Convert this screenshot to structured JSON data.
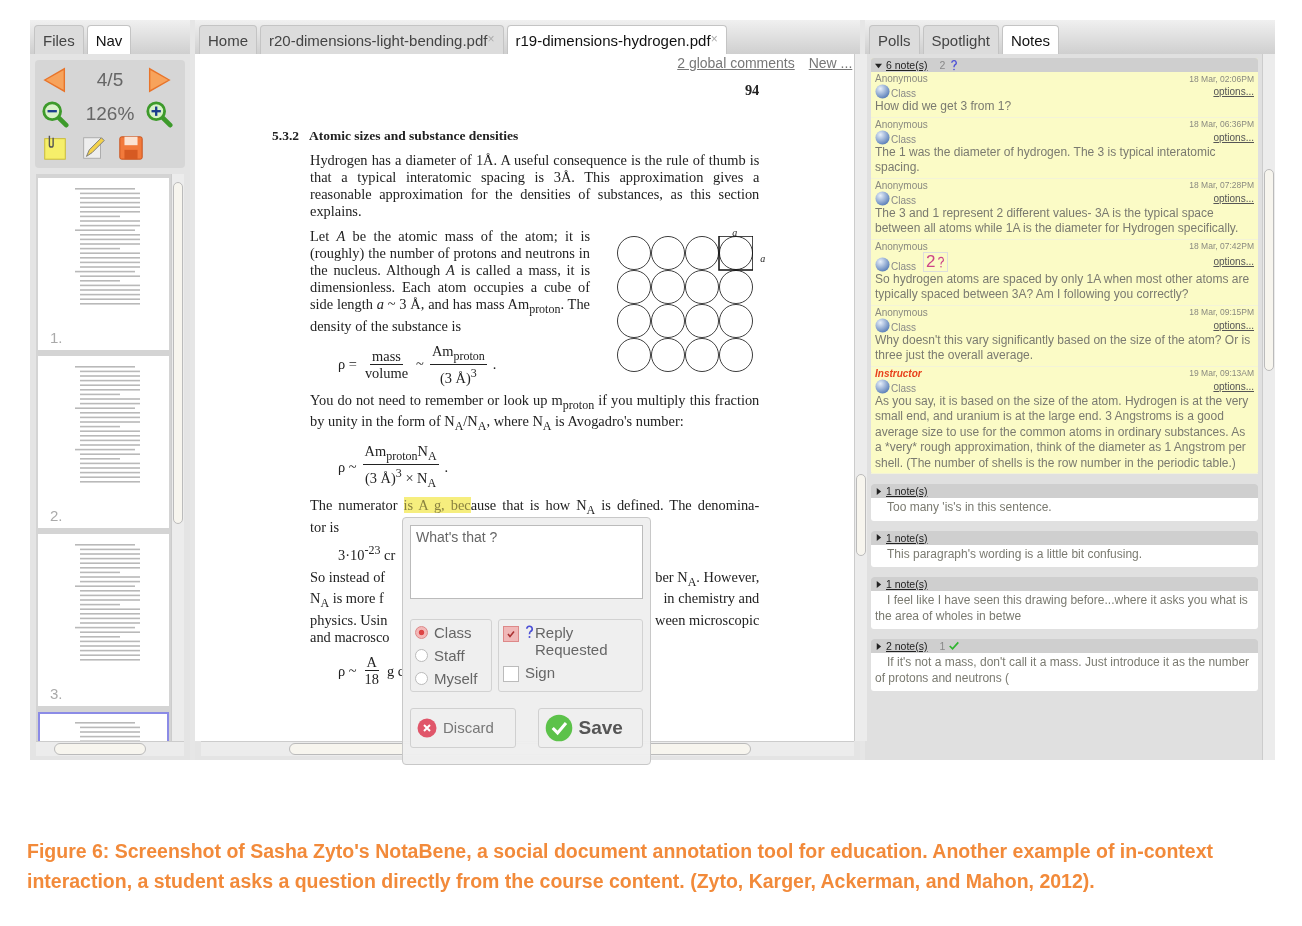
{
  "left_panel": {
    "tabs": [
      {
        "label": "Files",
        "selected": false
      },
      {
        "label": "Nav",
        "selected": true
      }
    ],
    "page_indicator": "4/5",
    "zoom": "126%",
    "thumbnails": [
      {
        "label": "1.",
        "selected": false
      },
      {
        "label": "2.",
        "selected": false
      },
      {
        "label": "3.",
        "selected": false
      },
      {
        "selected": true
      }
    ]
  },
  "document": {
    "tabs": [
      {
        "label": "Home",
        "selected": false
      },
      {
        "label": "r20-dimensions-light-bending.pdf",
        "selected": false,
        "close": "×"
      },
      {
        "label": "r19-dimensions-hydrogen.pdf",
        "selected": true,
        "close": "×"
      }
    ],
    "links": [
      "2 global comments",
      "New ..."
    ],
    "page_number": "94",
    "section_number": "5.3.2",
    "section_title": "Atomic sizes and substance densities",
    "blocks": [
      {
        "kind": "paragraph",
        "text": "Hydrogen has a diameter of 1Å. A useful consequence is the rule of thumb is that a typical interatomic spacing is 3Å. This approximation gives a reasonable approximation for the densities of substances, as this section explains."
      },
      {
        "kind": "figure_paragraph",
        "text": "Let *A* be the atomic mass of the atom; it is (roughly) the number of protons and neutrons in the nucleus. Although *A* is called a mass, it is dimensionless. Each atom occupies a cube of side length *a* ~ 3 Å, and has mass Am$_{proton}$. The density of the substance is",
        "figure_labels": [
          "a",
          "a"
        ]
      },
      {
        "kind": "formula",
        "parts": [
          {
            "kind": "text",
            "text": "ρ ="
          },
          {
            "kind": "fraction",
            "num": "mass",
            "den": "volume"
          },
          {
            "kind": "text",
            "text": "~"
          },
          {
            "kind": "fraction",
            "num": "Am$_{proton}$",
            "den": "(3 Å)$^{3}$"
          },
          {
            "kind": "text",
            "text": "."
          }
        ]
      },
      {
        "kind": "paragraph",
        "text": "You do not need to remember or look up m$_{proton}$ if you multiply this fraction by unity in the form of N$_{A}$/N$_{A}$, where N$_{A}$ is Avogadro's number:"
      },
      {
        "kind": "formula",
        "parts": [
          {
            "kind": "text",
            "text": "ρ ~"
          },
          {
            "kind": "fraction",
            "num": "Am$_{proton}$N$_{A}$",
            "den": "(3 Å)$^{3}$ × N$_{A}$"
          },
          {
            "kind": "text",
            "text": "."
          }
        ]
      },
      {
        "kind": "lines",
        "lines": [
          {
            "parts": [
              {
                "text": "The numerator ",
                "highlighted": false
              },
              {
                "text": "is A g, bec",
                "highlighted": true
              },
              {
                "text": "ause that is how N$_{A}$ is defined. The denomina-",
                "highlighted": false
              }
            ]
          },
          {
            "parts": [
              {
                "text": "tor is",
                "highlighted": false
              }
            ]
          }
        ]
      },
      {
        "kind": "formula",
        "parts": [
          {
            "kind": "text",
            "text": "3·10$^{-23}$ cr"
          }
        ]
      },
      {
        "kind": "split",
        "lines": [
          {
            "left": "So instead of",
            "right": "ber N$_{A}$. However,"
          },
          {
            "left": "N$_{A}$ is more f",
            "right": "in chemistry and"
          },
          {
            "left": "physics. Usin",
            "right": "ween microscopic"
          },
          {
            "left": "and macrosco"
          }
        ]
      },
      {
        "kind": "formula",
        "parts": [
          {
            "kind": "text",
            "text": "ρ ~"
          },
          {
            "kind": "fraction",
            "num": "A",
            "den": "18"
          },
          {
            "kind": "text",
            "text": "g c"
          }
        ]
      }
    ],
    "popup": {
      "value": "What's that ?",
      "audience": [
        {
          "label": "Class",
          "selected": true
        },
        {
          "label": "Staff",
          "selected": false
        },
        {
          "label": "Myself",
          "selected": false
        }
      ],
      "options": [
        {
          "label": "Reply Requested",
          "checked": true,
          "kind": "question"
        },
        {
          "label": "Sign",
          "checked": false,
          "kind": "plain"
        }
      ],
      "buttons": [
        {
          "label": "Discard",
          "kind": "discard"
        },
        {
          "label": "Save",
          "kind": "save"
        }
      ]
    }
  },
  "notes_panel": {
    "tabs": [
      {
        "label": "Polls",
        "selected": false
      },
      {
        "label": "Spotlight",
        "selected": false
      },
      {
        "label": "Notes",
        "selected": true
      }
    ],
    "threads": [
      {
        "count": "6 note(s)",
        "expanded": true,
        "badge": {
          "kind": "question",
          "count": "2"
        },
        "notes": [
          {
            "author": "Anonymous",
            "kind": "student",
            "time": "18 Mar, 02:06PM",
            "visibility": "Class",
            "action": "options...",
            "text": "How did we get 3 from 1?"
          },
          {
            "author": "Anonymous",
            "kind": "student",
            "time": "18 Mar, 06:36PM",
            "visibility": "Class",
            "action": "options...",
            "text": "The 1 was the diameter of hydrogen. The 3 is typical interatomic spacing."
          },
          {
            "author": "Anonymous",
            "kind": "student",
            "time": "18 Mar, 07:28PM",
            "visibility": "Class",
            "action": "options...",
            "text": "The 3 and 1 represent 2 different values- 3A is the typical space between all atoms while 1A is the diameter for Hydrogen specifically."
          },
          {
            "author": "Anonymous",
            "kind": "student",
            "time": "18 Mar, 07:42PM",
            "visibility": "Class",
            "action": "options...",
            "badge": {
              "kind": "question",
              "count": "2"
            },
            "text": "So hydrogen atoms are spaced by only 1A when most other atoms are typically spaced between 3A? Am I following you correctly?"
          },
          {
            "author": "Anonymous",
            "kind": "student",
            "time": "18 Mar, 09:15PM",
            "visibility": "Class",
            "action": "options...",
            "text": "Why doesn't this vary significantly based on the size of the atom? Or is three just the overall average."
          },
          {
            "author": "Instructor",
            "kind": "instructor",
            "time": "19 Mar, 09:13AM",
            "visibility": "Class",
            "action": "options...",
            "text": "As you say, it is based on the size of the atom. Hydrogen is at the very small end, and uranium is at the large end. 3 Angstroms is a good average size to use for the common atoms in ordinary substances. As a *very* rough approximation, think of the diameter as 1 Angstrom per shell. (The number of shells is the row number in the periodic table.)"
          }
        ]
      },
      {
        "count": "1 note(s)",
        "expanded": false,
        "preview": "Too many 'is's in this sentence."
      },
      {
        "count": "1 note(s)",
        "expanded": false,
        "preview": "This paragraph's wording is a little bit confusing."
      },
      {
        "count": "1 note(s)",
        "expanded": false,
        "preview": "I feel like I have seen this drawing before...where it asks you what is the area of wholes in betwe"
      },
      {
        "count": "2 note(s)",
        "expanded": false,
        "badge": {
          "kind": "check",
          "count": "1"
        },
        "preview": "If it's not a mass, don't call it a mass. Just introduce it as the number of protons and neutrons ("
      }
    ]
  },
  "caption": "Figure 6: Screenshot of Sasha Zyto's NotaBene, a social document annotation tool for education. Another example of in-context interaction, a student asks a question directly from the course content. (Zyto, Karger, Ackerman, and Mahon, 2012)."
}
